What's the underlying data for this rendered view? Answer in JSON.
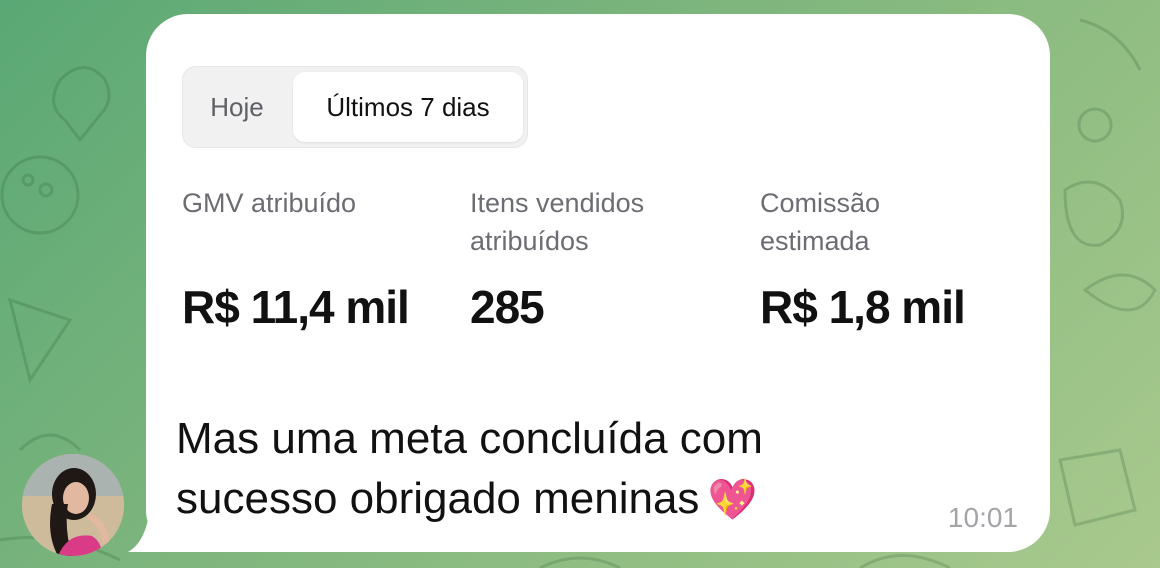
{
  "filter": {
    "options": [
      "Hoje",
      "Últimos 7 dias"
    ],
    "selected": "Últimos 7 dias"
  },
  "metrics": [
    {
      "label": "GMV atribuído",
      "value": "R$ 11,4 mil"
    },
    {
      "label": "Itens vendidos atribuídos",
      "value": "285"
    },
    {
      "label": "Comissão estimada",
      "value": "R$ 1,8 mil"
    }
  ],
  "message": {
    "text": "Mas uma meta concluída com sucesso obrigado meninas",
    "emoji": "💖",
    "emoji_name": "sparkling-heart-icon",
    "time": "10:01"
  },
  "colors": {
    "chat_background": "#78b37c",
    "bubble": "#ffffff",
    "muted_text": "#6c6d72",
    "timestamp": "#a2a4a8"
  }
}
